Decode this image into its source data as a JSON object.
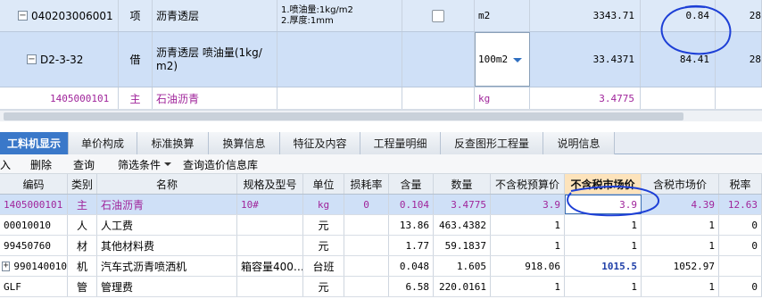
{
  "top_grid": {
    "rows": [
      {
        "code": "040203006001",
        "type": "项",
        "name": "沥青透层",
        "feature_lines": [
          "1.喷油量:1kg/m2",
          "2.厚度:1mm"
        ],
        "unit": "m2",
        "quantity": "3343.71",
        "price": "0.84",
        "extra": "28"
      },
      {
        "code": "D2-3-32",
        "type": "借",
        "name_lines": [
          "沥青透层 喷油量(1kg/",
          "m2)"
        ],
        "unit": "100m2",
        "quantity": "33.4371",
        "price": "84.41",
        "extra": "28"
      },
      {
        "code": "1405000101",
        "type": "主",
        "name": "石油沥青",
        "unit": "kg",
        "quantity": "3.4775"
      }
    ]
  },
  "tabs": [
    "工料机显示",
    "单价构成",
    "标准换算",
    "换算信息",
    "特征及内容",
    "工程量明细",
    "反查图形工程量",
    "说明信息"
  ],
  "toolbar": [
    "入",
    "删除",
    "查询",
    "筛选条件",
    "查询造价信息库"
  ],
  "lower_grid": {
    "headers": [
      "编码",
      "类别",
      "名称",
      "规格及型号",
      "单位",
      "损耗率",
      "含量",
      "数量",
      "不含税预算价",
      "不含税市场价",
      "含税市场价",
      "税率"
    ],
    "rows": [
      {
        "code": "1405000101",
        "cat": "主",
        "name": "石油沥青",
        "spec": "10#",
        "unit": "kg",
        "loss": "0",
        "content": "0.104",
        "qty": "3.4775",
        "budget": "3.9",
        "market": "3.9",
        "tax_market": "4.39",
        "rate": "12.63"
      },
      {
        "code": "00010010",
        "cat": "人",
        "name": "人工费",
        "spec": "",
        "unit": "元",
        "loss": "",
        "content": "13.86",
        "qty": "463.4382",
        "budget": "1",
        "market": "1",
        "tax_market": "1",
        "rate": "0"
      },
      {
        "code": "99450760",
        "cat": "材",
        "name": "其他材料费",
        "spec": "",
        "unit": "元",
        "loss": "",
        "content": "1.77",
        "qty": "59.1837",
        "budget": "1",
        "market": "1",
        "tax_market": "1",
        "rate": "0"
      },
      {
        "code": "990140010",
        "cat": "机",
        "name": "汽车式沥青喷洒机",
        "spec": "箱容量400…",
        "unit": "台班",
        "loss": "",
        "content": "0.048",
        "qty": "1.605",
        "budget": "918.06",
        "market": "1015.5",
        "tax_market": "1052.97",
        "rate": ""
      },
      {
        "code": "GLF",
        "cat": "管",
        "name": "管理费",
        "spec": "",
        "unit": "元",
        "loss": "",
        "content": "6.58",
        "qty": "220.0161",
        "budget": "1",
        "market": "1",
        "tax_market": "1",
        "rate": "0"
      }
    ]
  },
  "colors": {
    "selected_row": "#cfe0f7",
    "highlight_header": "#fde3bb",
    "active_tab": "#3a78c9",
    "annotation": "#1d3fd6",
    "main_material_text": "#a0259b"
  }
}
